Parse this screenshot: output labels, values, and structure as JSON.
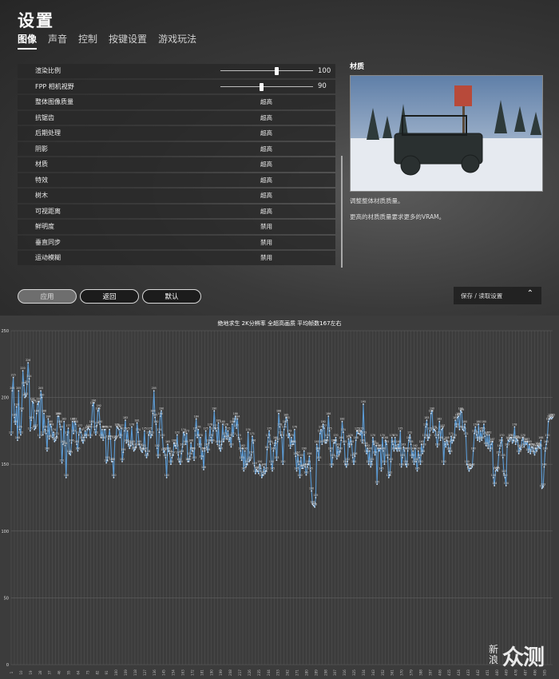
{
  "settings": {
    "title": "设置",
    "tabs": [
      {
        "label": "图像",
        "active": true
      },
      {
        "label": "声音",
        "active": false
      },
      {
        "label": "控制",
        "active": false
      },
      {
        "label": "按键设置",
        "active": false
      },
      {
        "label": "游戏玩法",
        "active": false
      }
    ],
    "options": [
      {
        "label": "渲染比例",
        "type": "slider",
        "value": "100",
        "fraction": 0.6
      },
      {
        "label": "FPP 相机视野",
        "type": "slider",
        "value": "90",
        "fraction": 0.44
      },
      {
        "label": "整体图像质量",
        "value": "超高"
      },
      {
        "label": "抗锯齿",
        "value": "超高"
      },
      {
        "label": "后期处理",
        "value": "超高"
      },
      {
        "label": "阴影",
        "value": "超高"
      },
      {
        "label": "材质",
        "value": "超高"
      },
      {
        "label": "特效",
        "value": "超高"
      },
      {
        "label": "树木",
        "value": "超高"
      },
      {
        "label": "可视距离",
        "value": "超高"
      },
      {
        "label": "鲜明度",
        "value": "禁用"
      },
      {
        "label": "垂直同步",
        "value": "禁用"
      },
      {
        "label": "运动模糊",
        "value": "禁用"
      }
    ],
    "buttons": {
      "apply": "应用",
      "back": "返回",
      "default": "默认"
    },
    "preview": {
      "title": "材质",
      "desc1": "调整整体材质质量。",
      "desc2": "更高的材质质量要求更多的VRAM。"
    },
    "save_load": "保存 / 读取设置"
  },
  "colors": {
    "line": "#5b9bd5",
    "grid": "#555555",
    "bg": "#3c3c3c"
  },
  "chart_data": {
    "type": "line",
    "title": "绝地求生 2K分辨率 全超高画质 平均帧数167左右",
    "ylim": [
      0,
      250
    ],
    "yticks": [
      0,
      50,
      100,
      150,
      200,
      250
    ],
    "x_start": 1,
    "x_step": 1,
    "series": [
      {
        "values": [
          172,
          205,
          215,
          185,
          180,
          193,
          168,
          205,
          176,
          172,
          190,
          220,
          209,
          200,
          201,
          210,
          226,
          214,
          175,
          183,
          197,
          196,
          176,
          177,
          188,
          195,
          197,
          170,
          205,
          200,
          172,
          188,
          176,
          173,
          160,
          184,
          169,
          180,
          178,
          170,
          174,
          167,
          168,
          171,
          186,
          186,
          180,
          176,
          151,
          165,
          182,
          164,
          140,
          172,
          177,
          158,
          157,
          166,
          182,
          173,
          182,
          180,
          165,
          160,
          172,
          177,
          174,
          168,
          166,
          170,
          175,
          170,
          176,
          177,
          176,
          170,
          180,
          194,
          196,
          176,
          172,
          179,
          190,
          192,
          180,
          170,
          176,
          168,
          176,
          176,
          151,
          153,
          169,
          176,
          169,
          152,
          152,
          140,
          168,
          169,
          178,
          177,
          176,
          170,
          177,
          152,
          159,
          175,
          183,
          166,
          175,
          165,
          162,
          164,
          178,
          165,
          160,
          161,
          163,
          181,
          174,
          165,
          163,
          160,
          159,
          162,
          175,
          160,
          155,
          158,
          172,
          175,
          170,
          172,
          188,
          205,
          185,
          180,
          162,
          155,
          174,
          186,
          190,
          170,
          159,
          160,
          155,
          140,
          165,
          160,
          158,
          150,
          155,
          157,
          166,
          164,
          162,
          172,
          157,
          152,
          150,
          158,
          163,
          174,
          172,
          165,
          173,
          152,
          152,
          156,
          166,
          160,
          160,
          153,
          175,
          184,
          170,
          176,
          163,
          170,
          154,
          160,
          146,
          160,
          175,
          163,
          159,
          166,
          178,
          170,
          166,
          175,
          190,
          177,
          175,
          165,
          181,
          162,
          160,
          165,
          180,
          167,
          171,
          178,
          169,
          175,
          167,
          170,
          163,
          180,
          171,
          182,
          186,
          177,
          184,
          170,
          167,
          160,
          153,
          162,
          145,
          160,
          148,
          150,
          174,
          152,
          153,
          157,
          171,
          166,
          149,
          143,
          146,
          145,
          143,
          150,
          147,
          140,
          142,
          148,
          143,
          145,
          161,
          170,
          175,
          165,
          150,
          145,
          160,
          164,
          168,
          153,
          167,
          188,
          178,
          172,
          170,
          150,
          176,
          180,
          185,
          183,
          170,
          173,
          162,
          170,
          165,
          165,
          176,
          156,
          145,
          157,
          150,
          140,
          155,
          147,
          147,
          160,
          148,
          142,
          148,
          150,
          156,
          145,
          130,
          120,
          119,
          118,
          125,
          165,
          160,
          153,
          173,
          176,
          165,
          180,
          177,
          166,
          166,
          170,
          186,
          175,
          160,
          148,
          155,
          166,
          166,
          170,
          154,
          163,
          157,
          160,
          168,
          182,
          174,
          165,
          150,
          148,
          152,
          169,
          163,
          170,
          165,
          155,
          150,
          156,
          168,
          175,
          173,
          173,
          172,
          175,
          166,
          195,
          172,
          164,
          158,
          162,
          150,
          160,
          148,
          152,
          170,
          165,
          157,
          164,
          135,
          162,
          160,
          162,
          145,
          170,
          160,
          150,
          168,
          165,
          155,
          140,
          142,
          152,
          170,
          165,
          160,
          170,
          162,
          160,
          165,
          160,
          175,
          148,
          155,
          163,
          160,
          150,
          148,
          160,
          168,
          172,
          165,
          155,
          160,
          150,
          162,
          152,
          145,
          160,
          155,
          150,
          165,
          158,
          163,
          170,
          178,
          183,
          168,
          170,
          175,
          188,
          190,
          174,
          176,
          175,
          170,
          163,
          172,
          182,
          168,
          176,
          177,
          150,
          167,
          163,
          168,
          165,
          160,
          158,
          171,
          166,
          168,
          170,
          183,
          178,
          185,
          186,
          176,
          190,
          189,
          176,
          175,
          180,
          171,
          150,
          148,
          145,
          147,
          147,
          148,
          160,
          173,
          178,
          172,
          168,
          180,
          167,
          175,
          168,
          175,
          180,
          171,
          164,
          172,
          162,
          172,
          160,
          165,
          167,
          140,
          134,
          145,
          146,
          145,
          157,
          162,
          166,
          170,
          155,
          143,
          140,
          134,
          163,
          168,
          167,
          170,
          170,
          166,
          168,
          178,
          165,
          169,
          168,
          158,
          162,
          161,
          168,
          170,
          163,
          167,
          165,
          167,
          159,
          165,
          158,
          163,
          163,
          160,
          157,
          162,
          160,
          164,
          163,
          162,
          168,
          132,
          133,
          148,
          160,
          165,
          170,
          182,
          184,
          185,
          184,
          185
        ]
      }
    ]
  },
  "watermark": {
    "small": "新浪",
    "big": "众测"
  }
}
